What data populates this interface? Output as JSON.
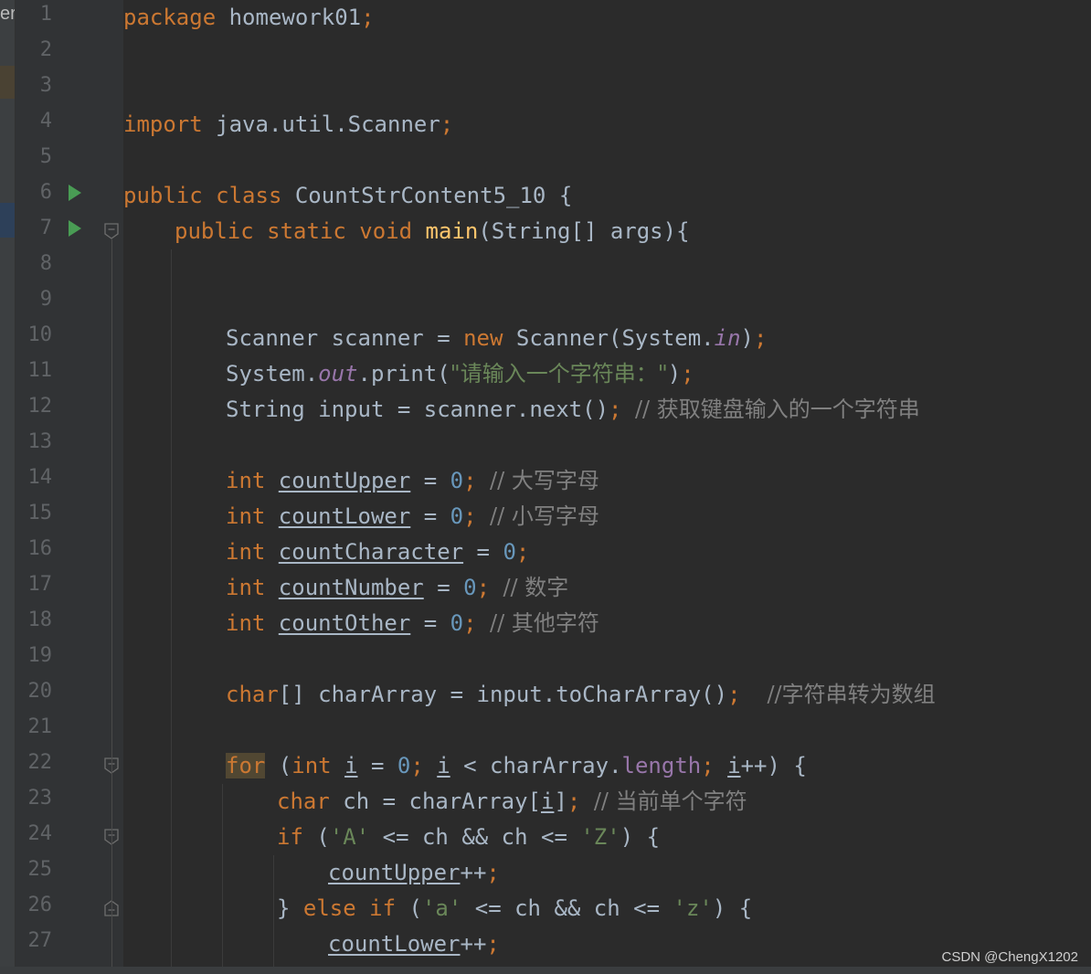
{
  "sidebar_fragment": "er",
  "watermark": "CSDN @ChengX1202",
  "lines": [
    {
      "n": "1",
      "indent": 0,
      "tokens": [
        {
          "t": "package",
          "c": "kw"
        },
        {
          "t": " homework01",
          "c": "pl"
        },
        {
          "t": ";",
          "c": "kw"
        }
      ]
    },
    {
      "n": "2",
      "indent": 0,
      "tokens": []
    },
    {
      "n": "3",
      "indent": 0,
      "tokens": []
    },
    {
      "n": "4",
      "indent": 0,
      "tokens": [
        {
          "t": "import",
          "c": "kw"
        },
        {
          "t": " java.util.Scanner",
          "c": "pl"
        },
        {
          "t": ";",
          "c": "kw"
        }
      ]
    },
    {
      "n": "5",
      "indent": 0,
      "tokens": []
    },
    {
      "n": "6",
      "indent": 0,
      "run": true,
      "tokens": [
        {
          "t": "public class ",
          "c": "kw"
        },
        {
          "t": "CountStrContent5_10 {",
          "c": "pl"
        }
      ]
    },
    {
      "n": "7",
      "indent": 4,
      "run": true,
      "fold": "open",
      "tokens": [
        {
          "t": "public static void ",
          "c": "kw"
        },
        {
          "t": "main",
          "c": "fn"
        },
        {
          "t": "(String[] args){",
          "c": "pl"
        }
      ]
    },
    {
      "n": "8",
      "indent": 0,
      "tokens": []
    },
    {
      "n": "9",
      "indent": 0,
      "tokens": []
    },
    {
      "n": "10",
      "indent": 8,
      "tokens": [
        {
          "t": "Scanner scanner = ",
          "c": "pl"
        },
        {
          "t": "new ",
          "c": "kw"
        },
        {
          "t": "Scanner(System.",
          "c": "pl"
        },
        {
          "t": "in",
          "c": "sf"
        },
        {
          "t": ")",
          "c": "pl"
        },
        {
          "t": ";",
          "c": "kw"
        }
      ]
    },
    {
      "n": "11",
      "indent": 8,
      "tokens": [
        {
          "t": "System.",
          "c": "pl"
        },
        {
          "t": "out",
          "c": "sf"
        },
        {
          "t": ".print(",
          "c": "pl"
        },
        {
          "t": "\"请输入一个字符串：\"",
          "c": "st"
        },
        {
          "t": ")",
          "c": "pl"
        },
        {
          "t": ";",
          "c": "kw"
        }
      ]
    },
    {
      "n": "12",
      "indent": 8,
      "tokens": [
        {
          "t": "String input = scanner.next()",
          "c": "pl"
        },
        {
          "t": "; ",
          "c": "kw"
        },
        {
          "t": "// 获取键盘输入的一个字符串",
          "c": "cm"
        }
      ]
    },
    {
      "n": "13",
      "indent": 0,
      "tokens": []
    },
    {
      "n": "14",
      "indent": 8,
      "tokens": [
        {
          "t": "int ",
          "c": "kw"
        },
        {
          "t": "countUpper",
          "c": "pl",
          "u": true
        },
        {
          "t": " = ",
          "c": "pl"
        },
        {
          "t": "0",
          "c": "nu"
        },
        {
          "t": "; ",
          "c": "kw"
        },
        {
          "t": "// 大写字母",
          "c": "cm"
        }
      ]
    },
    {
      "n": "15",
      "indent": 8,
      "tokens": [
        {
          "t": "int ",
          "c": "kw"
        },
        {
          "t": "countLower",
          "c": "pl",
          "u": true
        },
        {
          "t": " = ",
          "c": "pl"
        },
        {
          "t": "0",
          "c": "nu"
        },
        {
          "t": "; ",
          "c": "kw"
        },
        {
          "t": "// 小写字母",
          "c": "cm"
        }
      ]
    },
    {
      "n": "16",
      "indent": 8,
      "tokens": [
        {
          "t": "int ",
          "c": "kw"
        },
        {
          "t": "countCharacter",
          "c": "pl",
          "u": true
        },
        {
          "t": " = ",
          "c": "pl"
        },
        {
          "t": "0",
          "c": "nu"
        },
        {
          "t": ";",
          "c": "kw"
        }
      ]
    },
    {
      "n": "17",
      "indent": 8,
      "tokens": [
        {
          "t": "int ",
          "c": "kw"
        },
        {
          "t": "countNumber",
          "c": "pl",
          "u": true
        },
        {
          "t": " = ",
          "c": "pl"
        },
        {
          "t": "0",
          "c": "nu"
        },
        {
          "t": "; ",
          "c": "kw"
        },
        {
          "t": "// 数字",
          "c": "cm"
        }
      ]
    },
    {
      "n": "18",
      "indent": 8,
      "tokens": [
        {
          "t": "int ",
          "c": "kw"
        },
        {
          "t": "countOther",
          "c": "pl",
          "u": true
        },
        {
          "t": " = ",
          "c": "pl"
        },
        {
          "t": "0",
          "c": "nu"
        },
        {
          "t": "; ",
          "c": "kw"
        },
        {
          "t": "// 其他字符",
          "c": "cm"
        }
      ]
    },
    {
      "n": "19",
      "indent": 0,
      "tokens": []
    },
    {
      "n": "20",
      "indent": 8,
      "tokens": [
        {
          "t": "char",
          "c": "kw"
        },
        {
          "t": "[] charArray = input.toCharArray()",
          "c": "pl"
        },
        {
          "t": ";  ",
          "c": "kw"
        },
        {
          "t": "//字符串转为数组",
          "c": "cm"
        }
      ]
    },
    {
      "n": "21",
      "indent": 0,
      "tokens": []
    },
    {
      "n": "22",
      "indent": 8,
      "fold": "open",
      "tokens": [
        {
          "t": "for",
          "c": "kw",
          "h": true
        },
        {
          "t": " (",
          "c": "pl"
        },
        {
          "t": "int ",
          "c": "kw"
        },
        {
          "t": "i",
          "c": "pl",
          "u": true
        },
        {
          "t": " = ",
          "c": "pl"
        },
        {
          "t": "0",
          "c": "nu"
        },
        {
          "t": "; ",
          "c": "kw"
        },
        {
          "t": "i",
          "c": "pl",
          "u": true
        },
        {
          "t": " < charArray.",
          "c": "pl"
        },
        {
          "t": "length",
          "c": "fl"
        },
        {
          "t": "; ",
          "c": "kw"
        },
        {
          "t": "i",
          "c": "pl",
          "u": true
        },
        {
          "t": "++) {",
          "c": "pl"
        }
      ]
    },
    {
      "n": "23",
      "indent": 12,
      "tokens": [
        {
          "t": "char ",
          "c": "kw"
        },
        {
          "t": "ch = charArray[",
          "c": "pl"
        },
        {
          "t": "i",
          "c": "pl",
          "u": true
        },
        {
          "t": "]",
          "c": "pl"
        },
        {
          "t": "; ",
          "c": "kw"
        },
        {
          "t": "// 当前单个字符",
          "c": "cm"
        }
      ]
    },
    {
      "n": "24",
      "indent": 12,
      "fold": "open",
      "tokens": [
        {
          "t": "if ",
          "c": "kw"
        },
        {
          "t": "(",
          "c": "pl"
        },
        {
          "t": "'A'",
          "c": "st"
        },
        {
          "t": " <= ch && ch <= ",
          "c": "pl"
        },
        {
          "t": "'Z'",
          "c": "st"
        },
        {
          "t": ") {",
          "c": "pl"
        }
      ]
    },
    {
      "n": "25",
      "indent": 16,
      "tokens": [
        {
          "t": "countUpper",
          "c": "pl",
          "u": true
        },
        {
          "t": "++",
          "c": "pl"
        },
        {
          "t": ";",
          "c": "kw"
        }
      ]
    },
    {
      "n": "26",
      "indent": 12,
      "fold": "close",
      "tokens": [
        {
          "t": "} ",
          "c": "pl"
        },
        {
          "t": "else if ",
          "c": "kw"
        },
        {
          "t": "(",
          "c": "pl"
        },
        {
          "t": "'a'",
          "c": "st"
        },
        {
          "t": " <= ch && ch <= ",
          "c": "pl"
        },
        {
          "t": "'z'",
          "c": "st"
        },
        {
          "t": ") {",
          "c": "pl"
        }
      ]
    },
    {
      "n": "27",
      "indent": 16,
      "tokens": [
        {
          "t": "countLower",
          "c": "pl",
          "u": true
        },
        {
          "t": "++",
          "c": "pl"
        },
        {
          "t": ";",
          "c": "kw"
        }
      ]
    }
  ]
}
